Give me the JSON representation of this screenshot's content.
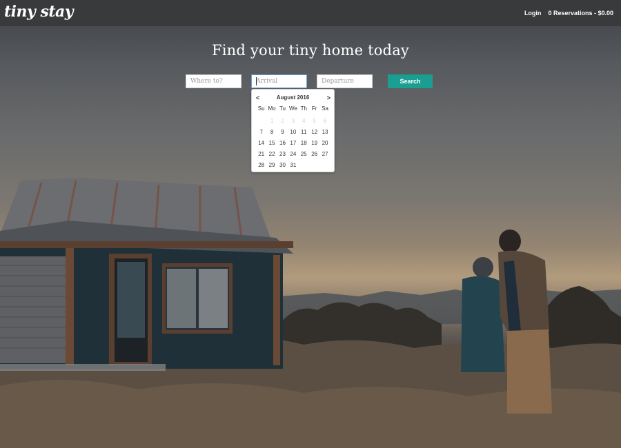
{
  "navbar": {
    "logo_text": "tiny stay",
    "login_label": "Login",
    "reservations_label": "0 Reservations - $0.00"
  },
  "hero": {
    "headline": "Find your tiny home today"
  },
  "search": {
    "where_placeholder": "Where to?",
    "arrival_placeholder": "Arrival",
    "departure_placeholder": "Departure",
    "button_label": "Search"
  },
  "datepicker": {
    "prev_label": "<",
    "next_label": ">",
    "title": "August 2016",
    "weekdays": [
      "Su",
      "Mo",
      "Tu",
      "We",
      "Th",
      "Fr",
      "Sa"
    ],
    "weeks": [
      [
        {
          "d": "",
          "o": false
        },
        {
          "d": "1",
          "o": true
        },
        {
          "d": "2",
          "o": true
        },
        {
          "d": "3",
          "o": true
        },
        {
          "d": "4",
          "o": true
        },
        {
          "d": "5",
          "o": true
        },
        {
          "d": "6",
          "o": true
        }
      ],
      [
        {
          "d": "7",
          "o": false
        },
        {
          "d": "8",
          "o": false
        },
        {
          "d": "9",
          "o": false
        },
        {
          "d": "10",
          "o": false
        },
        {
          "d": "11",
          "o": false
        },
        {
          "d": "12",
          "o": false
        },
        {
          "d": "13",
          "o": false
        }
      ],
      [
        {
          "d": "14",
          "o": false
        },
        {
          "d": "15",
          "o": false
        },
        {
          "d": "16",
          "o": false
        },
        {
          "d": "17",
          "o": false
        },
        {
          "d": "18",
          "o": false
        },
        {
          "d": "19",
          "o": false
        },
        {
          "d": "20",
          "o": false
        }
      ],
      [
        {
          "d": "21",
          "o": false
        },
        {
          "d": "22",
          "o": false
        },
        {
          "d": "23",
          "o": false
        },
        {
          "d": "24",
          "o": false
        },
        {
          "d": "25",
          "o": false
        },
        {
          "d": "26",
          "o": false
        },
        {
          "d": "27",
          "o": false
        }
      ],
      [
        {
          "d": "28",
          "o": false
        },
        {
          "d": "29",
          "o": false
        },
        {
          "d": "30",
          "o": false
        },
        {
          "d": "31",
          "o": false
        },
        {
          "d": "",
          "o": false
        },
        {
          "d": "",
          "o": false
        },
        {
          "d": "",
          "o": false
        }
      ]
    ]
  },
  "colors": {
    "navbar_bg": "#383a3b",
    "accent": "#199e91",
    "text_on_dark": "#ffffff"
  }
}
